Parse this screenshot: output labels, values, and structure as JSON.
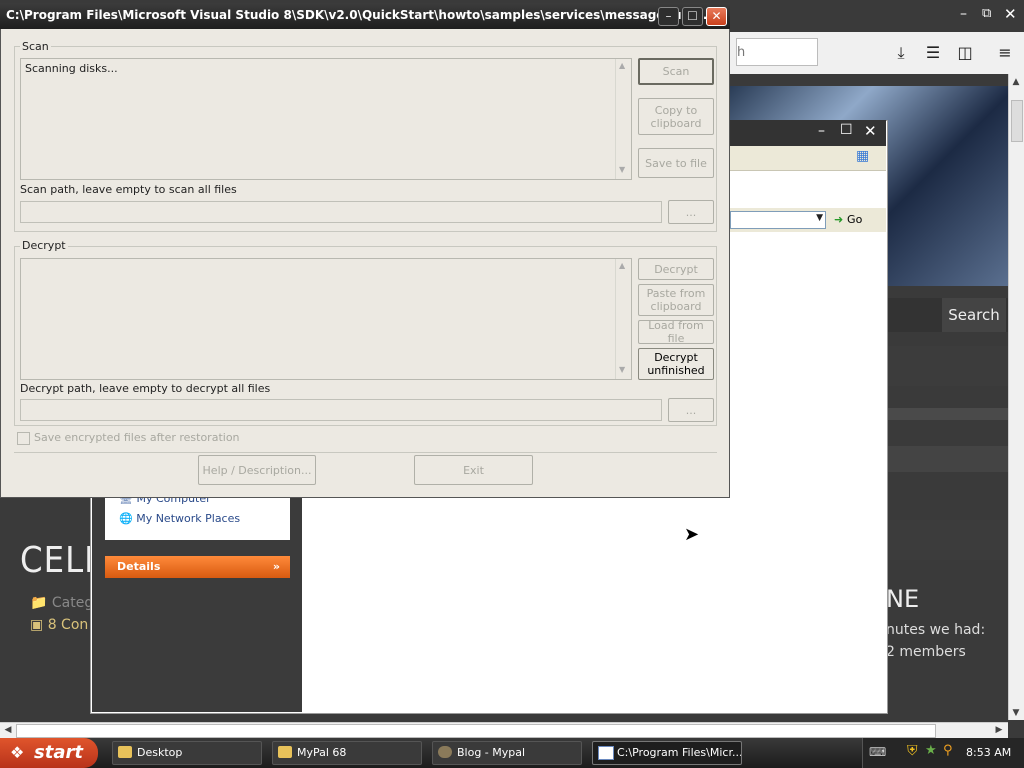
{
  "background_browser": {
    "search_placeholder": "h",
    "search_button": "Search",
    "blog_title": "CELLO",
    "categories": "Categ",
    "comments": "8 Con",
    "online_heading": "NE",
    "minutes_text": "nutes we had:",
    "members_text": "2 members",
    "toolbar_icons": [
      "download-icon",
      "library-icon",
      "sidebar-icon",
      "menu-icon"
    ]
  },
  "explorer": {
    "go_label": "Go",
    "places": [
      "My Computer",
      "My Network Places"
    ],
    "details_label": "Details"
  },
  "dialog": {
    "title": "C:\\Program Files\\Microsoft Visual Studio 8\\SDK\\v2.0\\QuickStart\\howto\\samples\\services\\messagequeu...",
    "scan": {
      "group_label": "Scan",
      "log_text": "Scanning disks...",
      "scan_button": "Scan",
      "copy_button": "Copy to clipboard",
      "save_button": "Save to file",
      "path_label": "Scan path, leave empty to scan all files",
      "path_value": "",
      "browse_button": "..."
    },
    "decrypt": {
      "group_label": "Decrypt",
      "log_text": "",
      "decrypt_button": "Decrypt",
      "paste_button": "Paste from clipboard",
      "load_button": "Load from file",
      "unfinished_button": "Decrypt unfinished",
      "path_label": "Decrypt path, leave empty to decrypt all files",
      "path_value": "",
      "browse_button": "..."
    },
    "save_encrypted_label": "Save encrypted files after restoration",
    "help_button": "Help / Description...",
    "exit_button": "Exit"
  },
  "taskbar": {
    "start_label": "start",
    "tasks": [
      {
        "label": "Desktop",
        "active": false
      },
      {
        "label": "MyPal 68",
        "active": false
      },
      {
        "label": "Blog - Mypal",
        "active": false
      },
      {
        "label": "C:\\Program Files\\Micr...",
        "active": true
      }
    ],
    "clock": "8:53 AM"
  }
}
